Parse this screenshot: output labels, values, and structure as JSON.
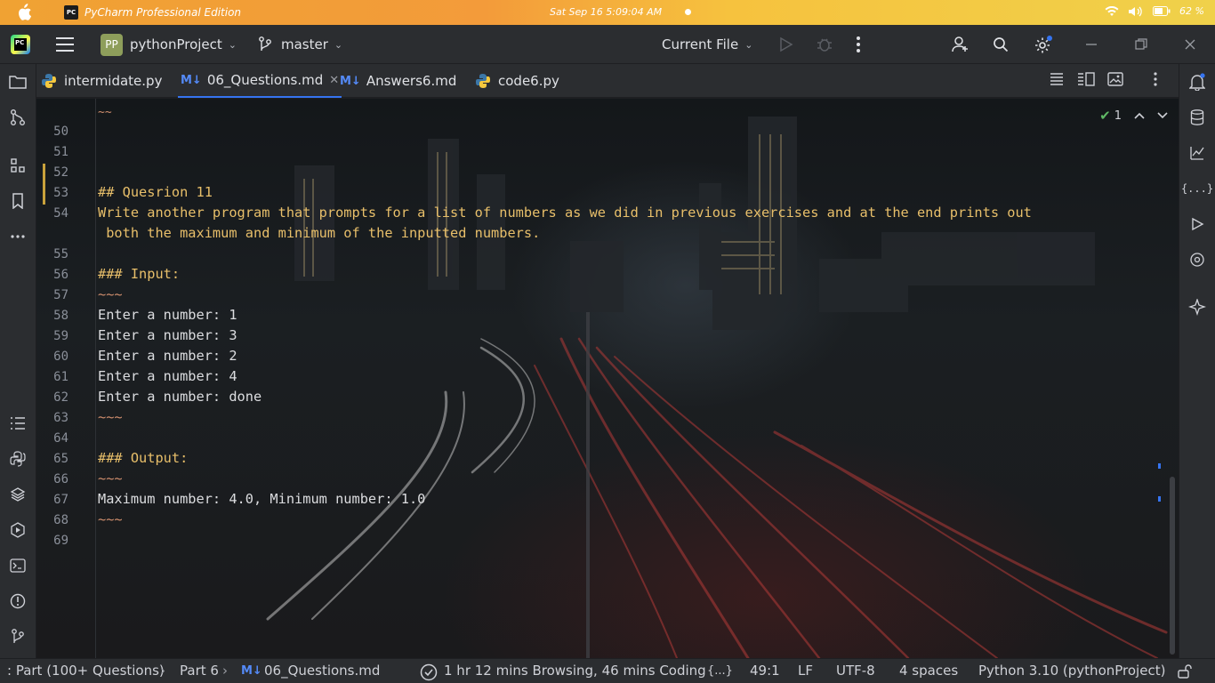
{
  "menubar": {
    "app_title": "PyCharm Professional Edition",
    "app_icon_text": "PC",
    "clock": "Sat Sep 16   5:09:04 AM",
    "battery": "62 %"
  },
  "toolbar": {
    "project_badge": "PP",
    "project_name": "pythonProject",
    "branch": "master",
    "run_config": "Current File"
  },
  "tabs": [
    {
      "label": "intermidate.py",
      "type": "py"
    },
    {
      "label": "06_Questions.md",
      "type": "md",
      "active": true
    },
    {
      "label": "Answers6.md",
      "type": "md"
    },
    {
      "label": "code6.py",
      "type": "py"
    }
  ],
  "md_icon": "M↓",
  "editor": {
    "inspection_count": "1",
    "top_fold": "~~",
    "lines": [
      {
        "n": "50",
        "text": "",
        "style": "plain"
      },
      {
        "n": "51",
        "text": "",
        "style": "plain"
      },
      {
        "n": "52",
        "text": "",
        "style": "plain"
      },
      {
        "n": "53",
        "text": "## Quesrion 11",
        "style": "head"
      },
      {
        "n": "54",
        "text": "Write another program that prompts for a list of numbers as we did in previous exercises and at the end prints out",
        "style": "head"
      },
      {
        "n": "",
        "text": " both the maximum and minimum of the inputted numbers.",
        "style": "head"
      },
      {
        "n": "55",
        "text": "",
        "style": "plain"
      },
      {
        "n": "56",
        "text": "### Input:",
        "style": "head"
      },
      {
        "n": "57",
        "text": "~~~",
        "style": "warn"
      },
      {
        "n": "58",
        "text": "Enter a number: 1",
        "style": "plain"
      },
      {
        "n": "59",
        "text": "Enter a number: 3",
        "style": "plain"
      },
      {
        "n": "60",
        "text": "Enter a number: 2",
        "style": "plain"
      },
      {
        "n": "61",
        "text": "Enter a number: 4",
        "style": "plain"
      },
      {
        "n": "62",
        "text": "Enter a number: done",
        "style": "plain"
      },
      {
        "n": "63",
        "text": "~~~",
        "style": "warn"
      },
      {
        "n": "64",
        "text": "",
        "style": "plain"
      },
      {
        "n": "65",
        "text": "### Output:",
        "style": "head"
      },
      {
        "n": "66",
        "text": "~~~",
        "style": "warn"
      },
      {
        "n": "67",
        "text": "Maximum number: 4.0, Minimum number: 1.0",
        "style": "plain"
      },
      {
        "n": "68",
        "text": "~~~",
        "style": "warn"
      },
      {
        "n": "69",
        "text": "",
        "style": "plain"
      }
    ]
  },
  "statusbar": {
    "crumb1": ": Part (100+ Questions)",
    "crumb2": "Part 6",
    "crumb3": "06_Questions.md",
    "time_tracking": "1 hr 12 mins Browsing, 46 mins Coding",
    "braces": "{...}",
    "position": "49:1",
    "line_sep": "LF",
    "encoding": "UTF-8",
    "indent": "4 spaces",
    "interpreter": "Python 3.10 (pythonProject)"
  },
  "colors": {
    "accent": "#3574f0",
    "heading": "#e8bf6a",
    "fence": "#cf8e6d",
    "modified": "#c9a23b"
  }
}
